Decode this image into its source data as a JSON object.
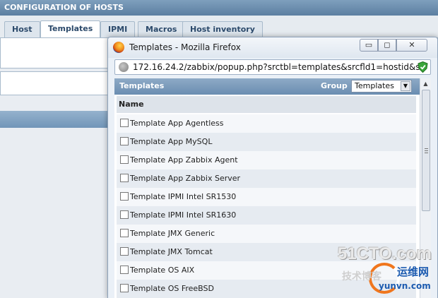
{
  "background": {
    "header_title": "CONFIGURATION OF HOSTS",
    "tabs": [
      {
        "label": "Host"
      },
      {
        "label": "Templates",
        "active": true
      },
      {
        "label": "IPMI"
      },
      {
        "label": "Macros"
      },
      {
        "label": "Host inventory"
      }
    ]
  },
  "popup": {
    "window_title": "Templates - Mozilla Firefox",
    "window_buttons": {
      "minimize": "▭",
      "maximize": "◻",
      "close": "✕"
    },
    "url": "172.16.24.2/zabbix/popup.php?srctbl=templates&srcfld1=hostid&s",
    "section_title": "Templates",
    "group_label": "Group",
    "group_selected": "Templates",
    "column_header": "Name",
    "rows": [
      {
        "name": "Template App Agentless"
      },
      {
        "name": "Template App MySQL"
      },
      {
        "name": "Template App Zabbix Agent"
      },
      {
        "name": "Template App Zabbix Server"
      },
      {
        "name": "Template IPMI Intel SR1530"
      },
      {
        "name": "Template IPMI Intel SR1630"
      },
      {
        "name": "Template JMX Generic"
      },
      {
        "name": "Template JMX Tomcat"
      },
      {
        "name": "Template OS AIX"
      },
      {
        "name": "Template OS FreeBSD"
      }
    ]
  },
  "watermark": {
    "line1": "51CTO.com",
    "line2": "技术博客",
    "line3": "运维网",
    "line4": "yunvn.com"
  },
  "colors": {
    "header_blue": "#6a8db1",
    "row_alt": "#e6ebf1",
    "shield_green": "#3aa63a"
  }
}
